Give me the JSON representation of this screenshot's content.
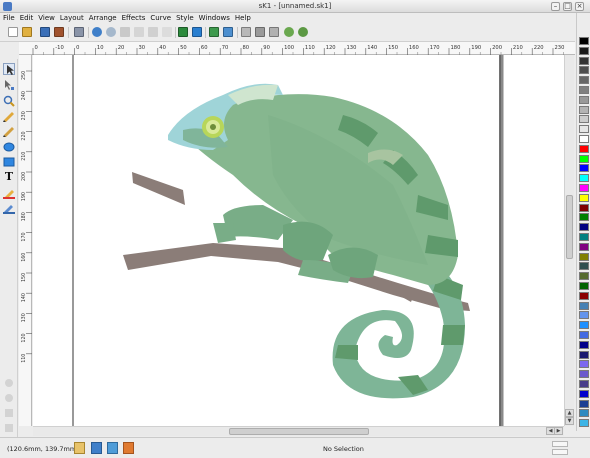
{
  "window": {
    "title": "sK1 - [unnamed.sk1]",
    "controls": [
      "minimize",
      "maximize",
      "close"
    ]
  },
  "menu": [
    {
      "label": "File"
    },
    {
      "label": "Edit"
    },
    {
      "label": "View"
    },
    {
      "label": "Layout"
    },
    {
      "label": "Arrange"
    },
    {
      "label": "Effects"
    },
    {
      "label": "Curve"
    },
    {
      "label": "Style"
    },
    {
      "label": "Windows"
    },
    {
      "label": "Help"
    }
  ],
  "toolbar": {
    "icons": [
      "new-icon",
      "open-icon",
      "save-icon",
      "save-as-icon",
      "print-icon",
      "undo-icon",
      "redo-icon",
      "cut-icon",
      "copy-icon",
      "paste-icon",
      "delete-icon",
      "import-icon",
      "export-icon",
      "group-icon",
      "ungroup-icon",
      "align-icon",
      "combine-icon",
      "break-icon",
      "zoom-in-icon",
      "zoom-out-icon",
      "zoom-fit-icon"
    ]
  },
  "ruler_top": {
    "labels": [
      "0",
      "-10",
      "0",
      "10",
      "20",
      "30",
      "40",
      "50",
      "60",
      "70",
      "80",
      "90",
      "100",
      "110",
      "120",
      "130",
      "140",
      "150",
      "160",
      "170",
      "180",
      "190",
      "200",
      "210",
      "220",
      "230"
    ]
  },
  "ruler_left": {
    "labels": [
      "250",
      "240",
      "230",
      "220",
      "210",
      "200",
      "190",
      "180",
      "170",
      "160",
      "150",
      "140",
      "130",
      "120",
      "110"
    ]
  },
  "tools": [
    "selector-icon",
    "node-edit-icon",
    "zoom-tool-icon",
    "freehand-icon",
    "bezier-icon",
    "ellipse-icon",
    "rectangle-icon",
    "text-icon",
    "fill-icon",
    "outline-icon"
  ],
  "palette": {
    "colors": [
      "#000000",
      "#1a1a1a",
      "#333333",
      "#4d4d4d",
      "#666666",
      "#808080",
      "#999999",
      "#b3b3b3",
      "#cccccc",
      "#e6e6e6",
      "#ffffff",
      "#ff0000",
      "#00ff00",
      "#0000ff",
      "#00ffff",
      "#ff00ff",
      "#ffff00",
      "#800000",
      "#008000",
      "#000080",
      "#008080",
      "#800080",
      "#808000",
      "#2f4f4f",
      "#556b2f",
      "#006400",
      "#8b0000",
      "#4682b4",
      "#6495ed",
      "#1e90ff",
      "#4169e1",
      "#00008b",
      "#191970",
      "#7b68ee",
      "#6a5acd",
      "#483d8b",
      "#0000cd",
      "#1c3f94",
      "#2e8bc0",
      "#3cb4e5"
    ]
  },
  "status": {
    "coords": "(120.6mm, 139.7mm)",
    "selection": "No Selection"
  }
}
